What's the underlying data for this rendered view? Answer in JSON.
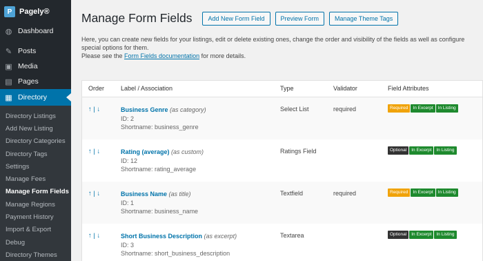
{
  "brand": {
    "name": "Pagely®",
    "logo": "P"
  },
  "sidebar": {
    "top": [
      {
        "label": "Dashboard",
        "icon": "dashboard-icon",
        "glyph": "◍"
      }
    ],
    "mid": [
      {
        "label": "Posts",
        "icon": "pin-icon",
        "glyph": "✎"
      },
      {
        "label": "Media",
        "icon": "media-icon",
        "glyph": "▣"
      },
      {
        "label": "Pages",
        "icon": "pages-icon",
        "glyph": "▤"
      }
    ],
    "active": {
      "label": "Directory",
      "icon": "directory-icon",
      "glyph": "▦"
    },
    "submenu": [
      "Directory Listings",
      "Add New Listing",
      "Directory Categories",
      "Directory Tags",
      "Settings",
      "Manage Fees",
      "Manage Form Fields",
      "Manage Regions",
      "Payment History",
      "Import & Export",
      "Debug",
      "Directory Themes"
    ],
    "current_submenu": "Manage Form Fields"
  },
  "header": {
    "title": "Manage Form Fields",
    "buttons": [
      "Add New Form Field",
      "Preview Form",
      "Manage Theme Tags"
    ]
  },
  "intro": {
    "line1": "Here, you can create new fields for your listings, edit or delete existing ones, change the order and visibility of the fields as well as configure special options for them.",
    "line2_pre": "Please see the ",
    "line2_link": "Form Fields documentation",
    "line2_post": " for more details."
  },
  "table": {
    "columns": {
      "order": "Order",
      "label": "Label / Association",
      "type": "Type",
      "validator": "Validator",
      "attributes": "Field Attributes"
    },
    "order_glyph": "↑ | ↓",
    "rows": [
      {
        "name": "Business Genre",
        "assoc": "(as category)",
        "id": "ID: 2",
        "shortname": "Shortname: business_genre",
        "type": "Select List",
        "validator": "required",
        "badges": [
          "Required",
          "In Excerpt",
          "In Listing"
        ]
      },
      {
        "name": "Rating (average)",
        "assoc": "(as custom)",
        "id": "ID: 12",
        "shortname": "Shortname: rating_average",
        "type": "Ratings Field",
        "validator": "",
        "badges": [
          "Optional",
          "In Excerpt",
          "In Listing"
        ]
      },
      {
        "name": "Business Name",
        "assoc": "(as title)",
        "id": "ID: 1",
        "shortname": "Shortname: business_name",
        "type": "Textfield",
        "validator": "required",
        "badges": [
          "Required",
          "In Excerpt",
          "In Listing"
        ]
      },
      {
        "name": "Short Business Description",
        "assoc": "(as excerpt)",
        "id": "ID: 3",
        "shortname": "Shortname: short_business_description",
        "type": "Textarea",
        "validator": "",
        "badges": [
          "Optional",
          "In Excerpt",
          "In Listing"
        ]
      }
    ]
  },
  "colors": {
    "sidebar": "#23282d",
    "accent": "#0073aa",
    "required": "#f0a30a",
    "optional": "#333333",
    "green": "#1e8a2e"
  }
}
